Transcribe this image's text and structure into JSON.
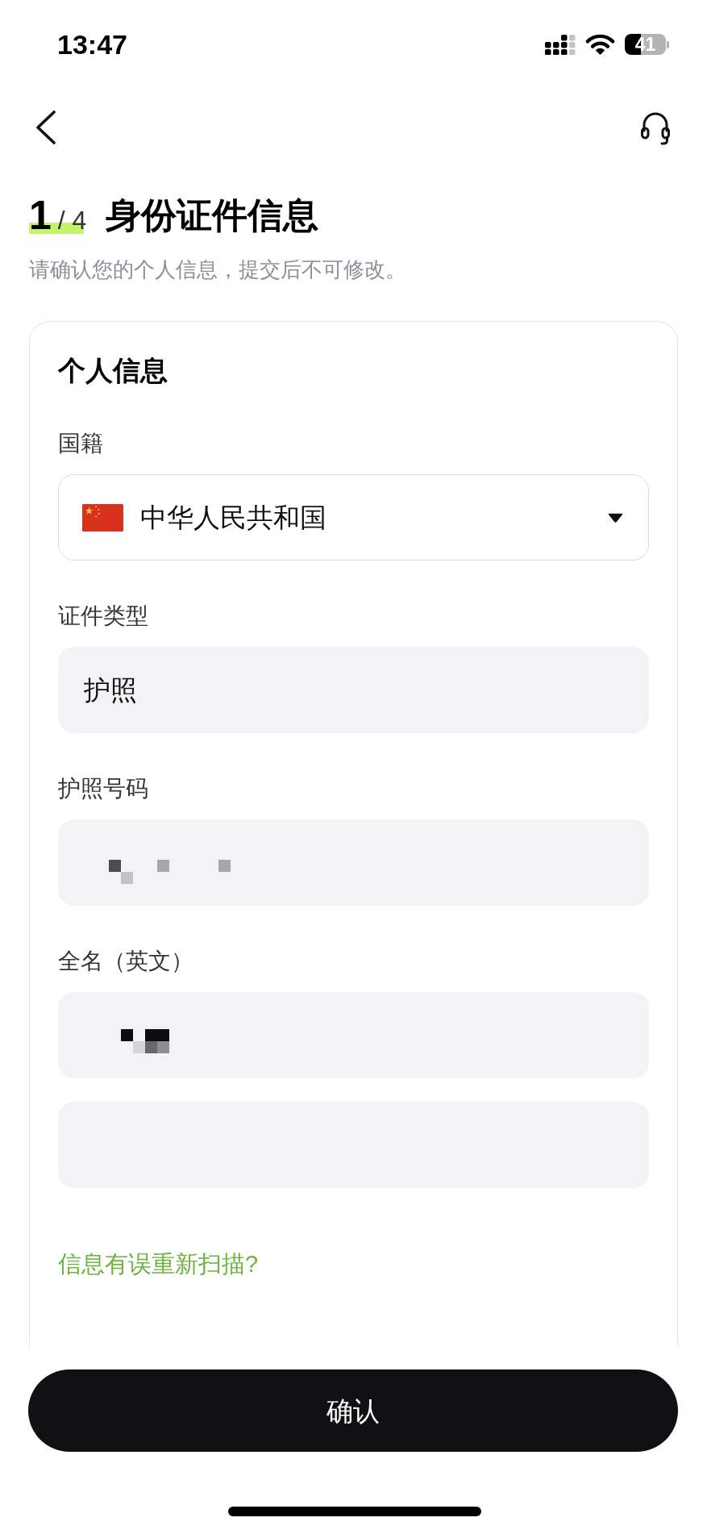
{
  "status_bar": {
    "time": "13:47",
    "battery": "41"
  },
  "header": {
    "step": "1",
    "step_total": "/ 4",
    "title": "身份证件信息",
    "subtitle": "请确认您的个人信息，提交后不可修改。"
  },
  "card": {
    "title": "个人信息",
    "fields": [
      {
        "kind": "select",
        "label": "国籍",
        "value": "中华人民共和国",
        "redacted": false
      },
      {
        "kind": "text",
        "label": "证件类型",
        "value": "护照",
        "redacted": false
      },
      {
        "kind": "text",
        "label": "护照号码",
        "redacted": true
      },
      {
        "kind": "text",
        "label": "全名（英文）",
        "redacted": true
      },
      {
        "kind": "text",
        "redacted": false
      }
    ],
    "link": "信息有误重新扫描?"
  },
  "button": "确认"
}
